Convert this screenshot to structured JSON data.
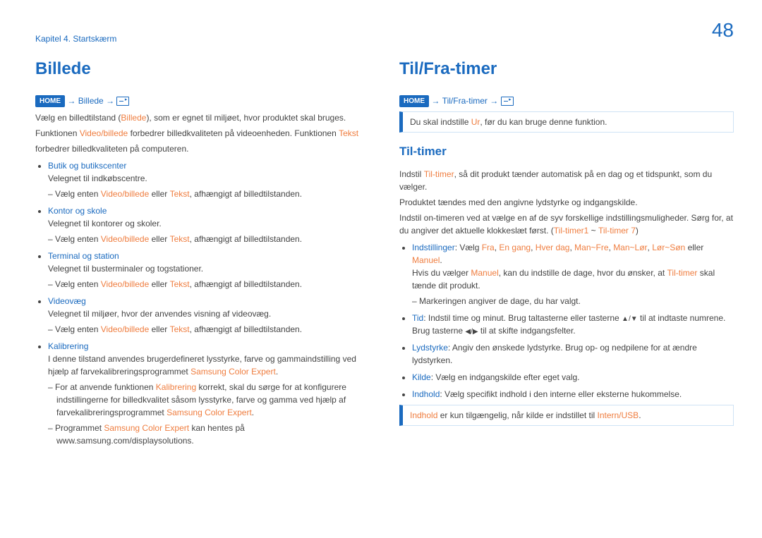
{
  "header": {
    "chapter": "Kapitel 4. Startskærm",
    "page_number": "48"
  },
  "nav": {
    "home_label": "HOME",
    "arrow": "→"
  },
  "left": {
    "title": "Billede",
    "path_link": "Billede",
    "intro": {
      "p1a": "Vælg en billedtilstand (",
      "p1b": "Billede",
      "p1c": "), som er egnet til miljøet, hvor produktet skal bruges.",
      "p2a": "Funktionen ",
      "p2b": "Video/billede",
      "p2c": " forbedrer billedkvaliteten på videoenheden. Funktionen ",
      "p2d": "Tekst",
      "p2e": "forbedrer billedkvaliteten på computeren."
    },
    "items": [
      {
        "label": "Butik og butikscenter",
        "desc": "Velegnet til indkøbscentre.",
        "sub_a": "Vælg enten ",
        "sub_b": "Video/billede",
        "sub_mid": " eller ",
        "sub_c": "Tekst",
        "sub_d": ", afhængigt af billedtilstanden."
      },
      {
        "label": "Kontor og skole",
        "desc": "Velegnet til kontorer og skoler.",
        "sub_a": "Vælg enten ",
        "sub_b": "Video/billede",
        "sub_mid": " eller ",
        "sub_c": "Tekst",
        "sub_d": ", afhængigt af billedtilstanden."
      },
      {
        "label": "Terminal og station",
        "desc": "Velegnet til busterminaler og togstationer.",
        "sub_a": "Vælg enten ",
        "sub_b": "Video/billede",
        "sub_mid": " eller ",
        "sub_c": "Tekst",
        "sub_d": ", afhængigt af billedtilstanden."
      },
      {
        "label": "Videovæg",
        "desc": "Velegnet til miljøer, hvor der anvendes visning af videovæg.",
        "sub_a": "Vælg enten ",
        "sub_b": "Video/billede",
        "sub_mid": " eller ",
        "sub_c": "Tekst",
        "sub_d": ", afhængigt af billedtilstanden."
      }
    ],
    "calib": {
      "label": "Kalibrering",
      "desc_a": "I denne tilstand anvendes brugerdefineret lysstyrke, farve og gammaindstilling ved hjælp af farvekalibreringsprogrammet ",
      "desc_b": "Samsung Color Expert",
      "desc_c": ".",
      "d1a": "For at anvende funktionen ",
      "d1b": "Kalibrering",
      "d1c": " korrekt, skal du sørge for at konfigurere indstillingerne for billedkvalitet såsom lysstyrke, farve og gamma ved hjælp af farvekalibreringsprogrammet ",
      "d1d": "Samsung Color Expert",
      "d1e": ".",
      "d2a": "Programmet ",
      "d2b": "Samsung Color Expert",
      "d2c": " kan hentes på www.samsung.com/displaysolutions."
    }
  },
  "right": {
    "title": "Til/Fra-timer",
    "path_link": "Til/Fra-timer",
    "note1a": "Du skal indstille ",
    "note1b": "Ur",
    "note1c": ", før du kan bruge denne funktion.",
    "subheading": "Til-timer",
    "p1a": "Indstil ",
    "p1b": "Til-timer",
    "p1c": ", så dit produkt tænder automatisk på en dag og et tidspunkt, som du vælger.",
    "p2": "Produktet tændes med den angivne lydstyrke og indgangskilde.",
    "p3a": "Indstil on-timeren ved at vælge en af de syv forskellige indstillingsmuligheder. Sørg for, at du angiver det aktuelle klokkeslæt først. (",
    "p3b": "Til-timer1",
    "p3c": " ~ ",
    "p3d": "Til-timer 7",
    "p3e": ")",
    "set": {
      "label": "Indstillinger",
      "colon": ": Vælg ",
      "o1": "Fra",
      "o2": "En gang",
      "o3": "Hver dag",
      "o4": "Man~Fre",
      "o5": "Man~Lør",
      "o6": "Lør~Søn",
      "sep": ", ",
      "or": " eller ",
      "o7": "Manuel",
      "dot": ".",
      "desc_a": "Hvis du vælger ",
      "desc_b": "Manuel",
      "desc_c": ", kan du indstille de dage, hvor du ønsker, at ",
      "desc_d": "Til-timer",
      "desc_e": " skal tænde dit produkt.",
      "dash1": "Markeringen angiver de dage, du har valgt."
    },
    "tid": {
      "label": "Tid",
      "text_a": ": Indstil time og minut. Brug taltasterne eller tasterne ",
      "text_b": " til at indtaste numrene. Brug tasterne ",
      "text_c": " til at skifte indgangsfelter.",
      "updown": "▲/▼",
      "leftright": "◀/▶"
    },
    "lyd": {
      "label": "Lydstyrke",
      "text": ": Angiv den ønskede lydstyrke. Brug op- og nedpilene for at ændre lydstyrken."
    },
    "kilde": {
      "label": "Kilde",
      "text": ": Vælg en indgangskilde efter eget valg."
    },
    "indhold": {
      "label": "Indhold",
      "text": ": Vælg specifikt indhold i den interne eller eksterne hukommelse."
    },
    "note2a": "Indhold",
    "note2b": " er kun tilgængelig, når kilde er indstillet til ",
    "note2c": "Intern/USB",
    "note2d": "."
  }
}
